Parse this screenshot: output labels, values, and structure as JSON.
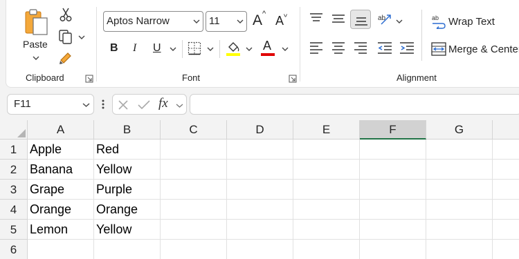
{
  "ribbon": {
    "clipboard": {
      "paste_label": "Paste",
      "group_label": "Clipboard"
    },
    "font": {
      "font_name": "Aptos Narrow",
      "font_size": "11",
      "group_label": "Font",
      "grow_label": "A",
      "shrink_label": "A",
      "bold_label": "B",
      "italic_label": "I",
      "underline_label": "U",
      "font_color_label": "A",
      "highlight_color": "#ffff00",
      "font_color": "#e00000"
    },
    "alignment": {
      "wrap_text_label": "Wrap Text",
      "merge_center_label": "Merge & Center",
      "group_label": "Alignment"
    }
  },
  "formula_bar": {
    "name_box": "F11",
    "fx_label": "fx",
    "formula": ""
  },
  "sheet": {
    "columns": [
      "A",
      "B",
      "C",
      "D",
      "E",
      "F",
      "G"
    ],
    "active_column": "F",
    "rows": [
      {
        "num": "1",
        "a": "Apple",
        "b": "Red"
      },
      {
        "num": "2",
        "a": "Banana",
        "b": "Yellow"
      },
      {
        "num": "3",
        "a": "Grape",
        "b": "Purple"
      },
      {
        "num": "4",
        "a": "Orange",
        "b": "Orange"
      },
      {
        "num": "5",
        "a": "Lemon",
        "b": "Yellow"
      },
      {
        "num": "6",
        "a": "",
        "b": ""
      }
    ]
  }
}
